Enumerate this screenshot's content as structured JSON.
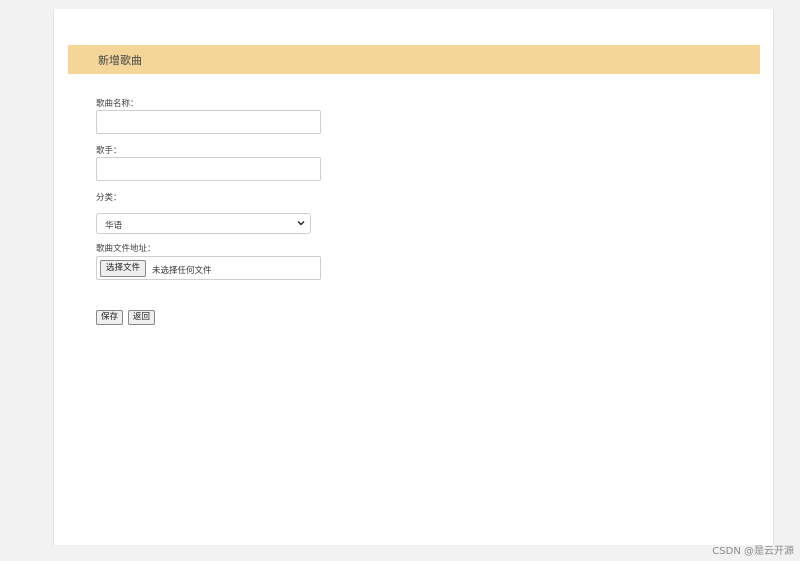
{
  "header": {
    "title": "新增歌曲"
  },
  "form": {
    "song_name_label": "歌曲名称：",
    "song_name_value": "",
    "singer_label": "歌手：",
    "singer_value": "",
    "category_label": "分类：",
    "category_selected": "华语",
    "file_label": "歌曲文件地址：",
    "file_button_label": "选择文件",
    "file_status": "未选择任何文件"
  },
  "actions": {
    "save_label": "保存",
    "back_label": "返回"
  },
  "watermark": {
    "text": "CSDN @是云开源"
  }
}
